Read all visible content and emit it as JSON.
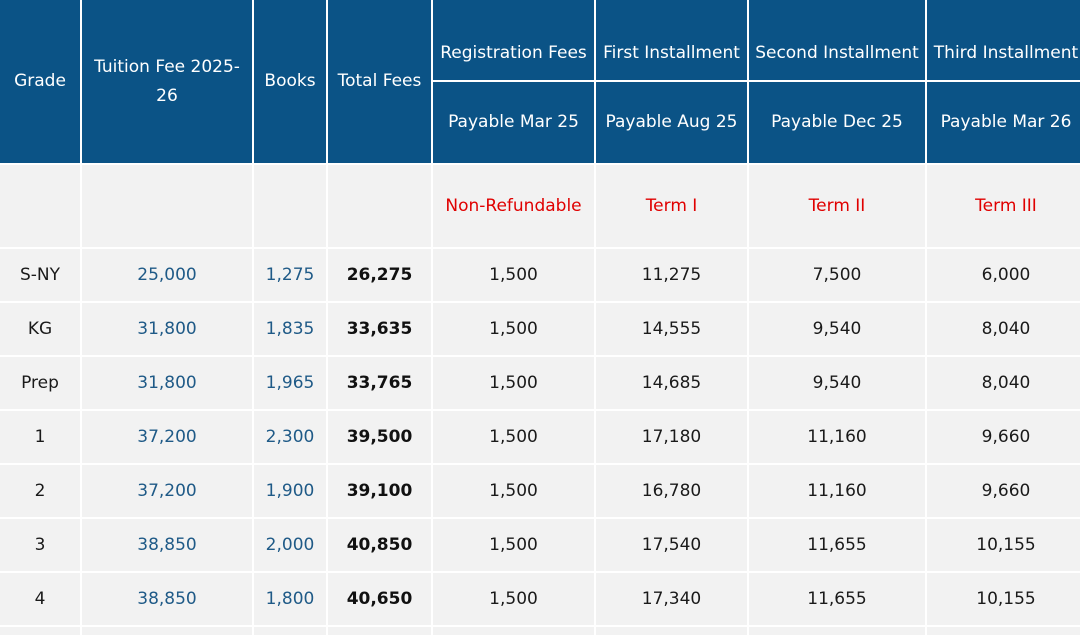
{
  "header": {
    "grade": "Grade",
    "tuition": "Tuition Fee 2025-26",
    "books": "Books",
    "total": "Total Fees",
    "registration": "Registration Fees",
    "first": "First Installment",
    "second": "Second Installment",
    "third": "Third Installment",
    "registration_due": "Payable Mar 25",
    "first_due": "Payable Aug 25",
    "second_due": "Payable Dec 25",
    "third_due": "Payable Mar 26"
  },
  "terms": {
    "registration": "Non-Refundable",
    "first": "Term I",
    "second": "Term II",
    "third": "Term III"
  },
  "rows": [
    {
      "grade": "S-NY",
      "tuition": "25,000",
      "books": "1,275",
      "total": "26,275",
      "registration": "1,500",
      "first": "11,275",
      "second": "7,500",
      "third": "6,000"
    },
    {
      "grade": "KG",
      "tuition": "31,800",
      "books": "1,835",
      "total": "33,635",
      "registration": "1,500",
      "first": "14,555",
      "second": "9,540",
      "third": "8,040"
    },
    {
      "grade": "Prep",
      "tuition": "31,800",
      "books": "1,965",
      "total": "33,765",
      "registration": "1,500",
      "first": "14,685",
      "second": "9,540",
      "third": "8,040"
    },
    {
      "grade": "1",
      "tuition": "37,200",
      "books": "2,300",
      "total": "39,500",
      "registration": "1,500",
      "first": "17,180",
      "second": "11,160",
      "third": "9,660"
    },
    {
      "grade": "2",
      "tuition": "37,200",
      "books": "1,900",
      "total": "39,100",
      "registration": "1,500",
      "first": "16,780",
      "second": "11,160",
      "third": "9,660"
    },
    {
      "grade": "3",
      "tuition": "38,850",
      "books": "2,000",
      "total": "40,850",
      "registration": "1,500",
      "first": "17,540",
      "second": "11,655",
      "third": "10,155"
    },
    {
      "grade": "4",
      "tuition": "38,850",
      "books": "1,800",
      "total": "40,650",
      "registration": "1,500",
      "first": "17,340",
      "second": "11,655",
      "third": "10,155"
    }
  ],
  "colors": {
    "header_bg": "#0b5386",
    "header_text": "#ffffff",
    "cell_bg": "#f2f2f2",
    "link_text": "#1f5a87",
    "term_text": "#e00000"
  }
}
